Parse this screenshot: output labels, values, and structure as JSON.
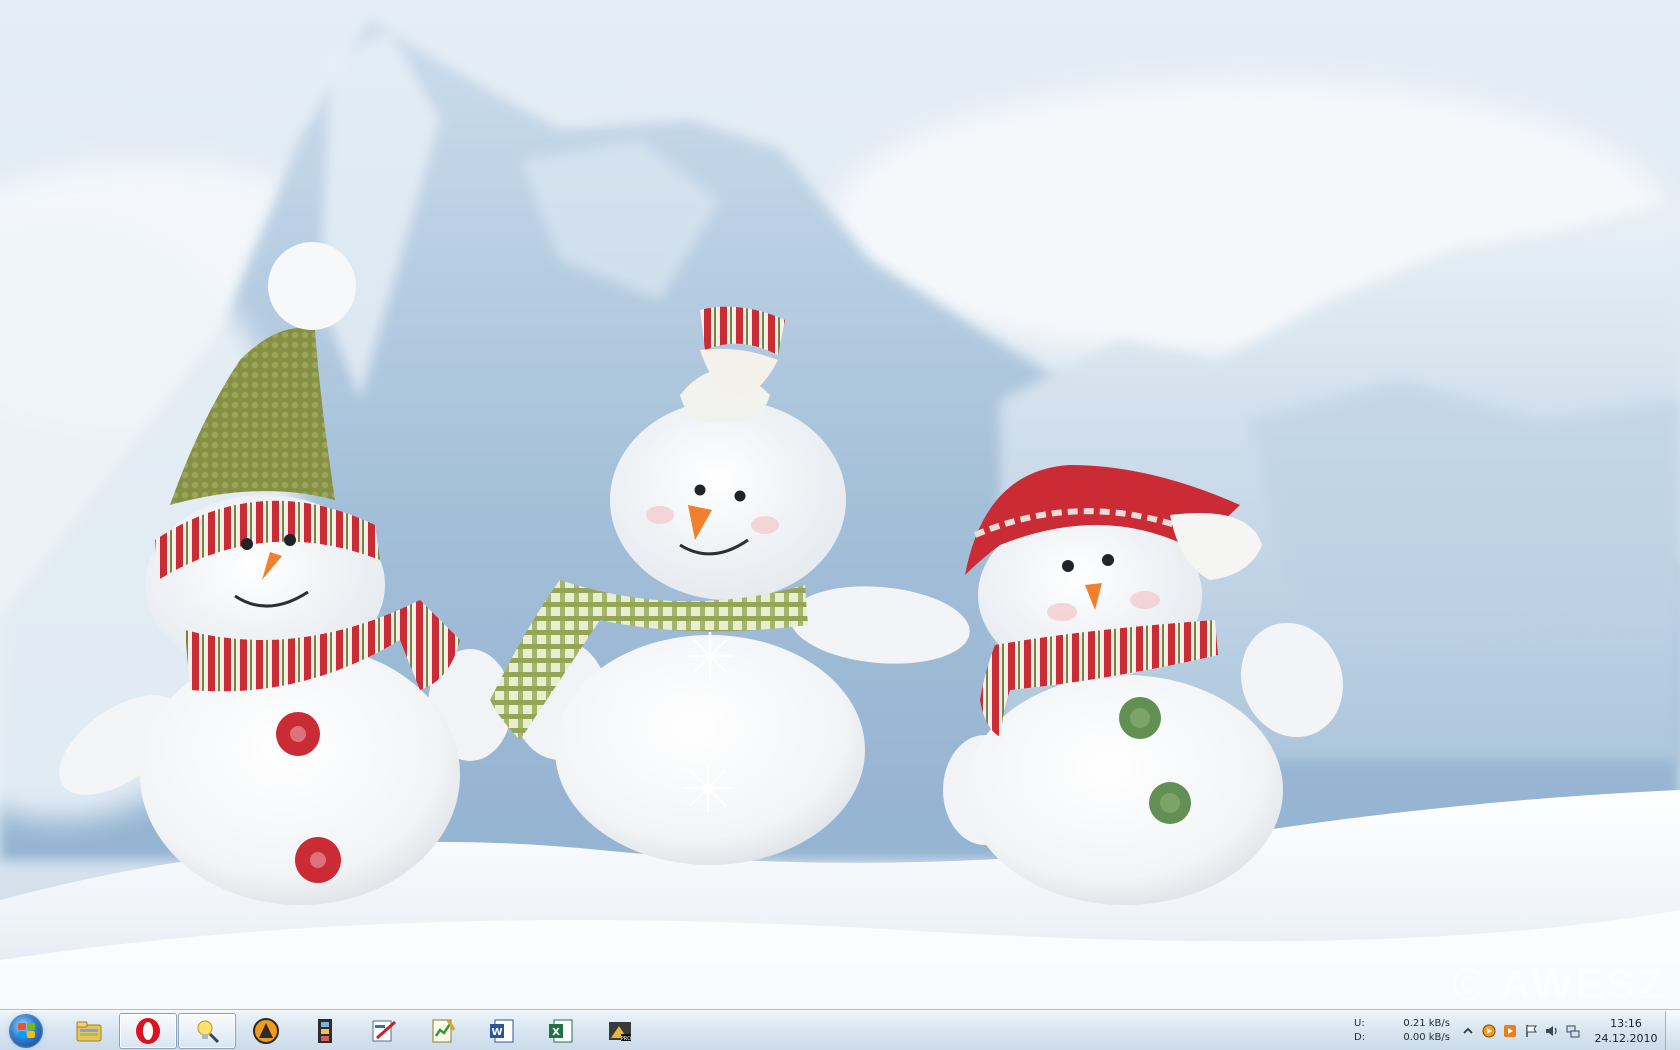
{
  "desktop": {
    "watermark": "© AWESZ"
  },
  "taskbar": {
    "start_label": "Start",
    "items": [
      {
        "name": "windows-explorer",
        "running": false
      },
      {
        "name": "opera-browser",
        "running": true
      },
      {
        "name": "tips-application",
        "running": true
      },
      {
        "name": "aimp-player",
        "running": false
      },
      {
        "name": "video-editor",
        "running": false
      },
      {
        "name": "paint-application",
        "running": false
      },
      {
        "name": "chart-notes",
        "running": false
      },
      {
        "name": "microsoft-word",
        "running": false
      },
      {
        "name": "microsoft-excel",
        "running": false
      },
      {
        "name": "pro-application",
        "running": false
      }
    ]
  },
  "tray": {
    "net": {
      "upload_label": "U:",
      "upload_value": "0.21 kB/s",
      "download_label": "D:",
      "download_value": "0.00 kB/s"
    },
    "clock": {
      "time": "13:16",
      "date": "24.12.2010"
    }
  },
  "colors": {
    "sky": "#dbe8f3",
    "mountain": "#b7cee3",
    "snow": "#f6f9fc",
    "red_accent": "#c8202a",
    "green_accent": "#7d8a3a"
  }
}
